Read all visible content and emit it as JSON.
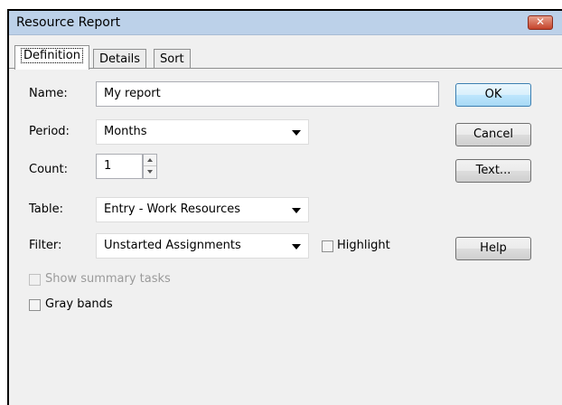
{
  "window": {
    "title": "Resource Report",
    "close_glyph": "✕"
  },
  "tabs": [
    {
      "label": "Definition",
      "active": true
    },
    {
      "label": "Details",
      "active": false
    },
    {
      "label": "Sort",
      "active": false
    }
  ],
  "form": {
    "name_label": "Name:",
    "name_value": "My report",
    "period_label": "Period:",
    "period_value": "Months",
    "count_label": "Count:",
    "count_value": "1",
    "table_label": "Table:",
    "table_value": "Entry - Work Resources",
    "filter_label": "Filter:",
    "filter_value": "Unstarted Assignments",
    "highlight_label": "Highlight",
    "highlight_checked": false,
    "show_summary_label": "Show summary tasks",
    "show_summary_checked": false,
    "show_summary_enabled": false,
    "gray_bands_label": "Gray bands",
    "gray_bands_checked": false
  },
  "buttons": {
    "ok": "OK",
    "cancel": "Cancel",
    "text": "Text...",
    "help": "Help"
  },
  "icons": {
    "close": "close-icon",
    "dropdown": "chevron-down-icon",
    "spin_up": "spin-up-icon",
    "spin_down": "spin-down-icon"
  }
}
